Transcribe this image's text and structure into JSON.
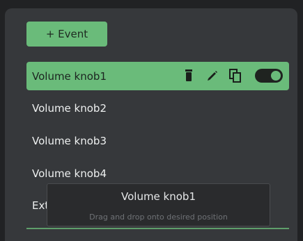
{
  "add_button": {
    "label": "+ Event"
  },
  "events": [
    {
      "label": "Volume knob1",
      "active": true
    },
    {
      "label": "Volume knob2",
      "active": false
    },
    {
      "label": "Volume knob3",
      "active": false
    },
    {
      "label": "Volume knob4",
      "active": false
    },
    {
      "label": "External Mute",
      "active": false
    }
  ],
  "actions": {
    "delete_icon": "trash-icon",
    "edit_icon": "pencil-icon",
    "copy_icon": "copy-icon",
    "toggle_state": "on"
  },
  "tooltip": {
    "title": "Volume knob1",
    "hint": "Drag and drop onto desired position"
  },
  "colors": {
    "accent": "#6abb7a",
    "panel": "#36383b",
    "background": "#212224"
  }
}
